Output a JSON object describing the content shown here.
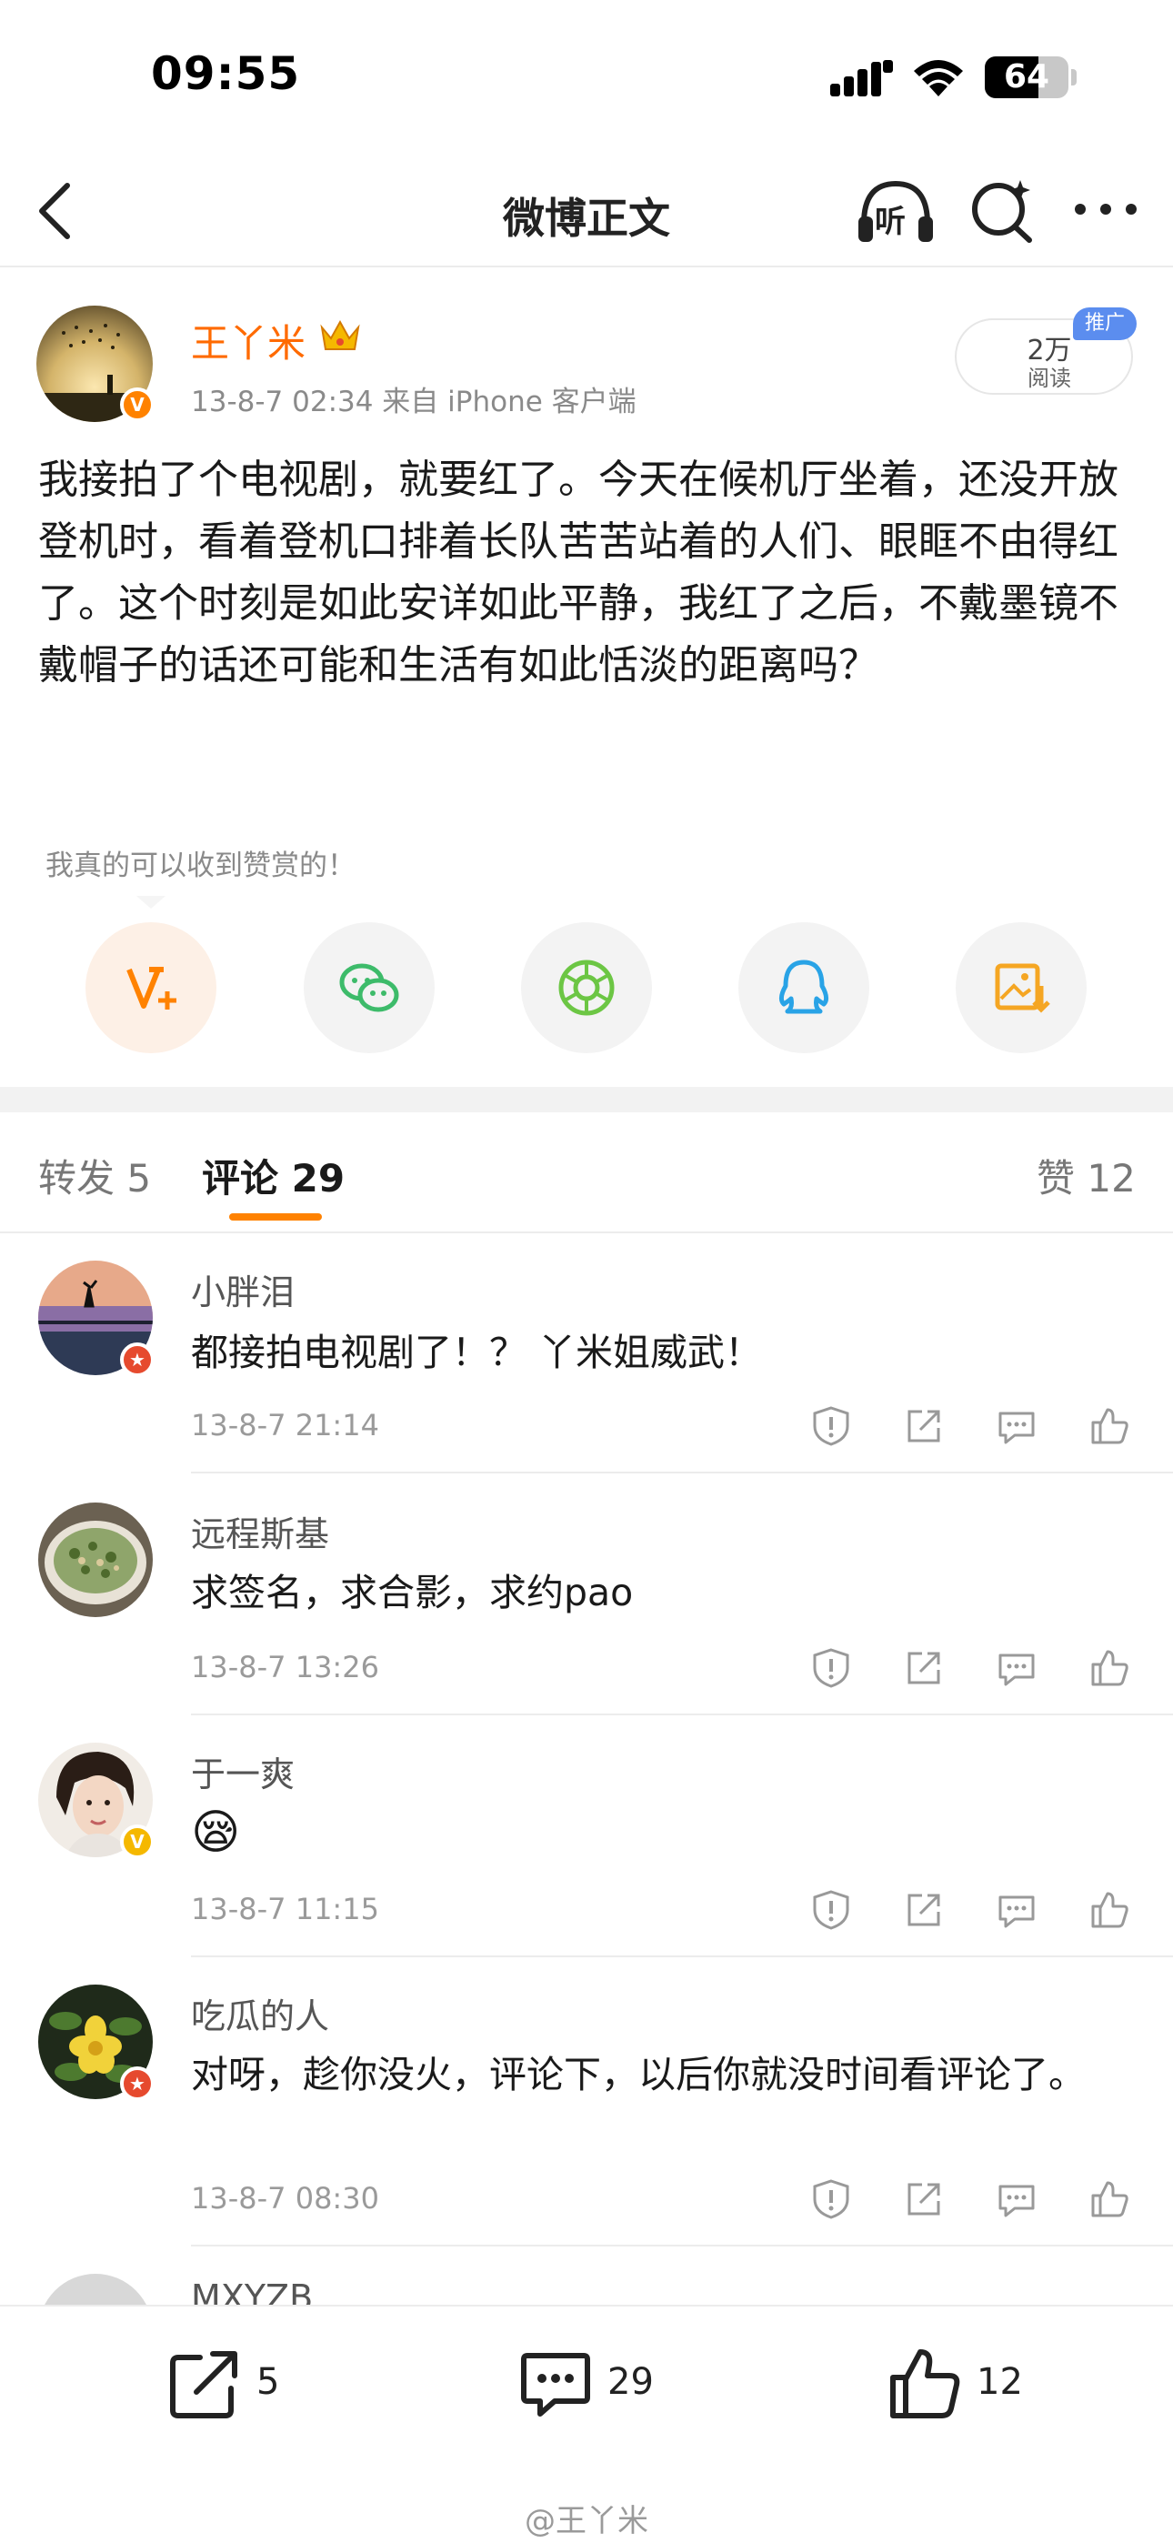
{
  "status_bar": {
    "time": "09:55",
    "battery": "64",
    "battery_level": 0.64
  },
  "nav": {
    "title": "微博正文",
    "listen_label": "听"
  },
  "post": {
    "author": "王丫米",
    "meta": "13-8-7 02:34  来自 iPhone 客户端",
    "read_count": "2万",
    "read_label": "阅读",
    "promo_tag": "推广",
    "body": "我接拍了个电视剧，就要红了。今天在候机厅坐着，还没开放登机时，看着登机口排着长队苦苦站着的人们、眼眶不由得红了。这个时刻是如此安详如此平静，我红了之后，不戴墨镜不戴帽子的话还可能和生活有如此恬淡的距离吗？",
    "reward_tip": "我真的可以收到赞赏的！",
    "share_icons": [
      "reward-icon",
      "wechat-icon",
      "moments-icon",
      "qq-icon",
      "save-image-icon"
    ]
  },
  "tabs": {
    "repost": "转发 5",
    "comments": "评论 29",
    "likes": "赞 12"
  },
  "comments": [
    {
      "name": "小胖泪",
      "text": "都接拍电视剧了！？ 丫米姐威武！",
      "time": "13-8-7 21:14",
      "badge": "red"
    },
    {
      "name": "远程斯基",
      "text": "求签名，求合影，求约pao",
      "time": "13-8-7 13:26",
      "badge": "none"
    },
    {
      "name": "于一爽",
      "text": "😪",
      "time": "13-8-7 11:15",
      "badge": "yellow"
    },
    {
      "name": "吃瓜的人",
      "text": "对呀，趁你没火，评论下，以后你就没时间看评论了。",
      "time": "13-8-7 08:30",
      "badge": "red"
    },
    {
      "name": "MXYZB",
      "text": "",
      "time": "",
      "badge": "none"
    }
  ],
  "bottom_bar": {
    "repost_count": "5",
    "comment_count": "29",
    "like_count": "12",
    "watermark": "@王丫米"
  },
  "colors": {
    "accent": "#ff8200",
    "name_orange": "#ff6a00",
    "badge_red": "#e64a2e",
    "badge_yellow": "#f5b800"
  }
}
